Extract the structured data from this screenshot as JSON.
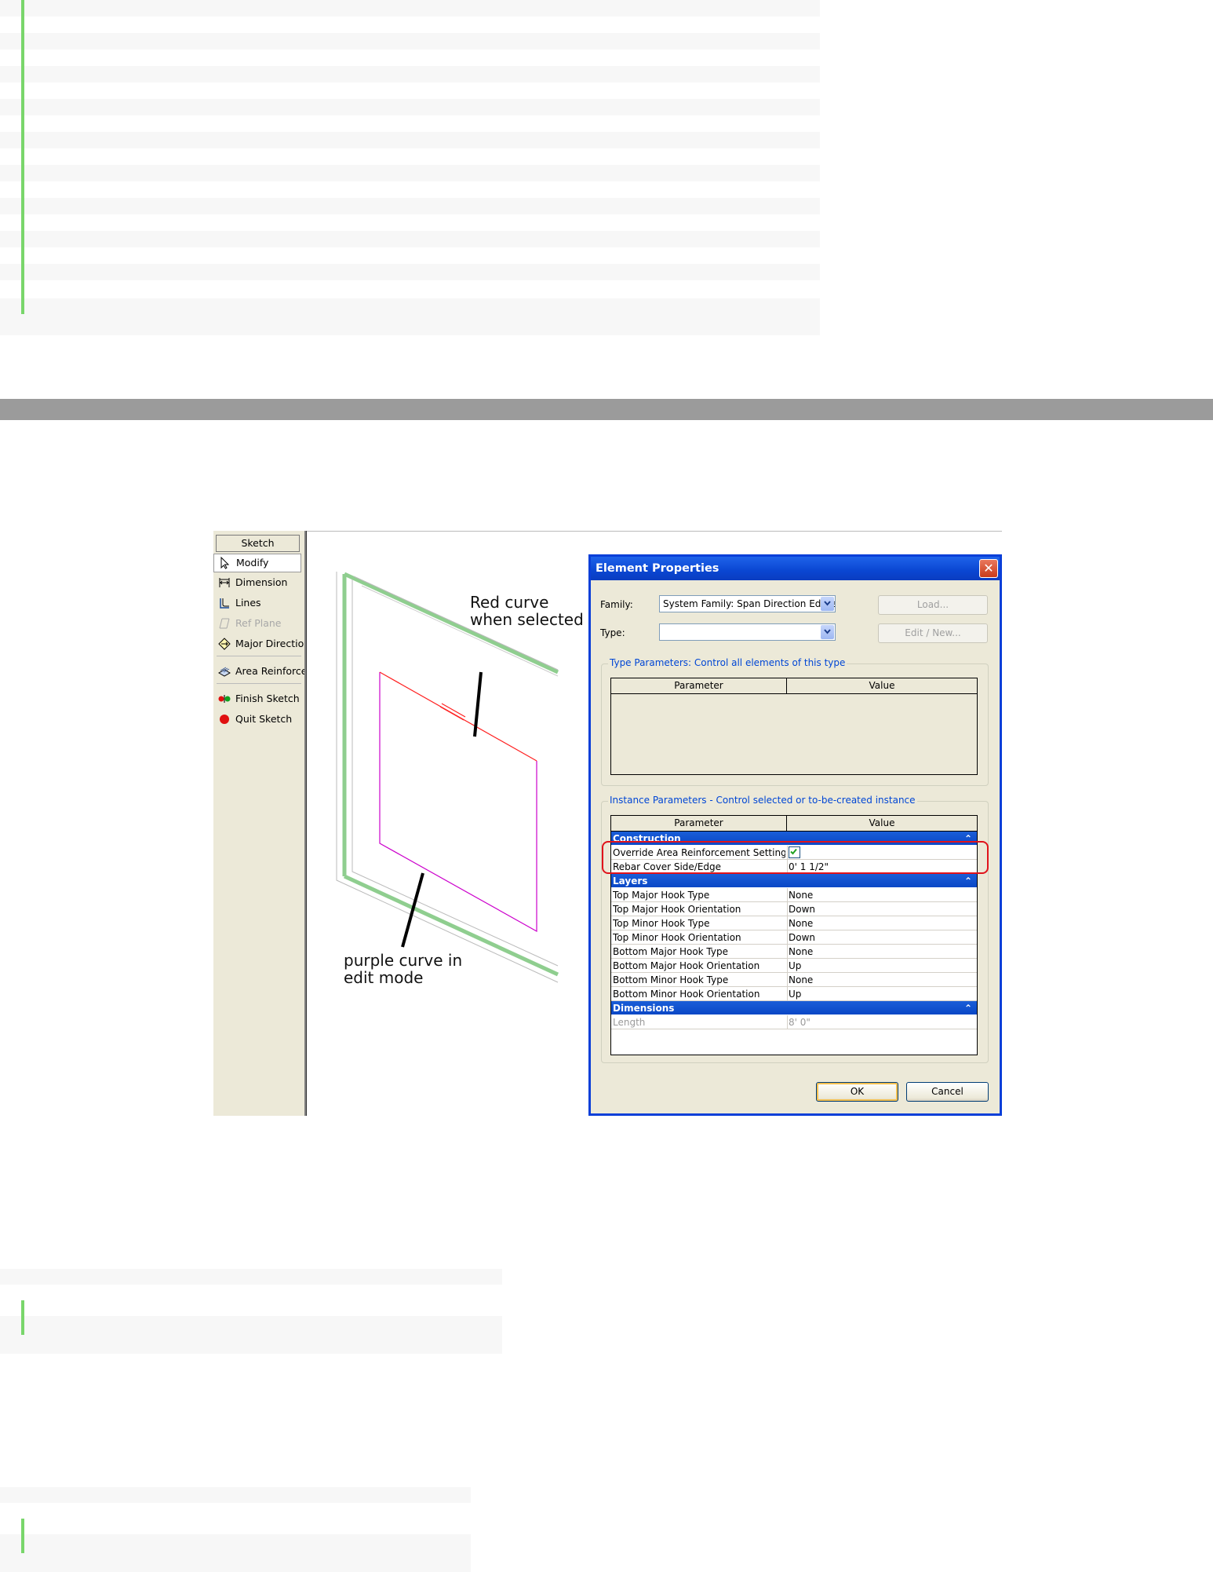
{
  "sketch_panel": {
    "title": "Sketch",
    "items": [
      {
        "label": "Modify",
        "icon": "cursor-arrow-icon"
      },
      {
        "label": "Dimension",
        "icon": "dimension-icon"
      },
      {
        "label": "Lines",
        "icon": "lines-icon"
      },
      {
        "label": "Ref Plane",
        "icon": "ref-plane-icon"
      },
      {
        "label": "Major Direction",
        "icon": "major-direction-icon"
      },
      {
        "label": "Area Reinforcement",
        "icon": "area-reinforcement-icon"
      },
      {
        "label": "Finish Sketch",
        "icon": "finish-sketch-icon"
      },
      {
        "label": "Quit Sketch",
        "icon": "quit-sketch-icon"
      }
    ]
  },
  "annotations": {
    "red_curve_line1": "Red curve",
    "red_curve_line2": "when selected",
    "purple_curve_line1": "purple curve in",
    "purple_curve_line2": "edit mode"
  },
  "colors": {
    "selected_curve": "#ff2020",
    "edit_curve": "#cc00cc",
    "wall_outline": "#8fce8f",
    "highlight": "#e0131b"
  },
  "dialog": {
    "title": "Element Properties",
    "close_glyph": "✕",
    "family_label": "Family:",
    "family_value": "System Family: Span Direction Edges",
    "type_label": "Type:",
    "type_value": "",
    "load_button": "Load...",
    "edit_new_button": "Edit / New...",
    "type_params_caption": "Type Parameters: Control all elements of this type",
    "instance_params_caption": "Instance Parameters - Control selected or to-be-created instance",
    "col_parameter": "Parameter",
    "col_value": "Value",
    "categories": {
      "construction": "Construction",
      "layers": "Layers",
      "dimensions": "Dimensions"
    },
    "construction_rows": [
      {
        "param": "Override Area Reinforcement Settings",
        "value": "checked"
      },
      {
        "param": "Rebar Cover Side/Edge",
        "value": "0'  1 1/2\""
      }
    ],
    "layers_rows": [
      {
        "param": "Top Major Hook Type",
        "value": "None"
      },
      {
        "param": "Top Major Hook Orientation",
        "value": "Down"
      },
      {
        "param": "Top Minor Hook Type",
        "value": "None"
      },
      {
        "param": "Top Minor Hook Orientation",
        "value": "Down"
      },
      {
        "param": "Bottom Major Hook Type",
        "value": "None"
      },
      {
        "param": "Bottom Major Hook Orientation",
        "value": "Up"
      },
      {
        "param": "Bottom Minor Hook Type",
        "value": "None"
      },
      {
        "param": "Bottom Minor Hook Orientation",
        "value": "Up"
      }
    ],
    "dimensions_rows": [
      {
        "param": "Length",
        "value": "8'  0\""
      }
    ],
    "ok_button": "OK",
    "cancel_button": "Cancel"
  }
}
